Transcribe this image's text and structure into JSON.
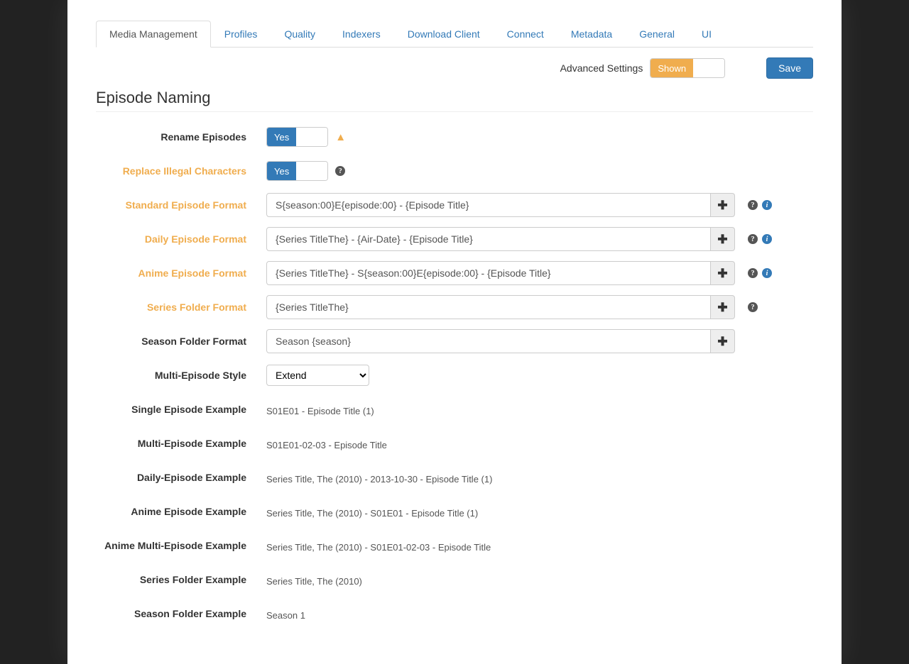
{
  "tabs": [
    "Media Management",
    "Profiles",
    "Quality",
    "Indexers",
    "Download Client",
    "Connect",
    "Metadata",
    "General",
    "UI"
  ],
  "activeTab": 0,
  "toolbar": {
    "advancedLabel": "Advanced Settings",
    "advancedToggle": "Shown",
    "saveLabel": "Save"
  },
  "section": "Episode Naming",
  "rows": {
    "renameEpisodes": {
      "label": "Rename Episodes",
      "toggle": "Yes"
    },
    "replaceIllegal": {
      "label": "Replace Illegal Characters",
      "toggle": "Yes"
    },
    "standardFormat": {
      "label": "Standard Episode Format",
      "value": "S{season:00}E{episode:00} - {Episode Title}"
    },
    "dailyFormat": {
      "label": "Daily Episode Format",
      "value": "{Series TitleThe} - {Air-Date} - {Episode Title}"
    },
    "animeFormat": {
      "label": "Anime Episode Format",
      "value": "{Series TitleThe} - S{season:00}E{episode:00} - {Episode Title}"
    },
    "seriesFolder": {
      "label": "Series Folder Format",
      "value": "{Series TitleThe}"
    },
    "seasonFolder": {
      "label": "Season Folder Format",
      "value": "Season {season}"
    },
    "multiStyle": {
      "label": "Multi-Episode Style",
      "value": "Extend"
    },
    "singleExample": {
      "label": "Single Episode Example",
      "value": "S01E01 - Episode Title (1)"
    },
    "multiExample": {
      "label": "Multi-Episode Example",
      "value": "S01E01-02-03 - Episode Title"
    },
    "dailyExample": {
      "label": "Daily-Episode Example",
      "value": "Series Title, The (2010) - 2013-10-30 - Episode Title (1)"
    },
    "animeExample": {
      "label": "Anime Episode Example",
      "value": "Series Title, The (2010) - S01E01 - Episode Title (1)"
    },
    "animeMultiExample": {
      "label": "Anime Multi-Episode Example",
      "value": "Series Title, The (2010) - S01E01-02-03 - Episode Title"
    },
    "seriesFolderExample": {
      "label": "Series Folder Example",
      "value": "Series Title, The (2010)"
    },
    "seasonFolderExample": {
      "label": "Season Folder Example",
      "value": "Season 1"
    }
  }
}
